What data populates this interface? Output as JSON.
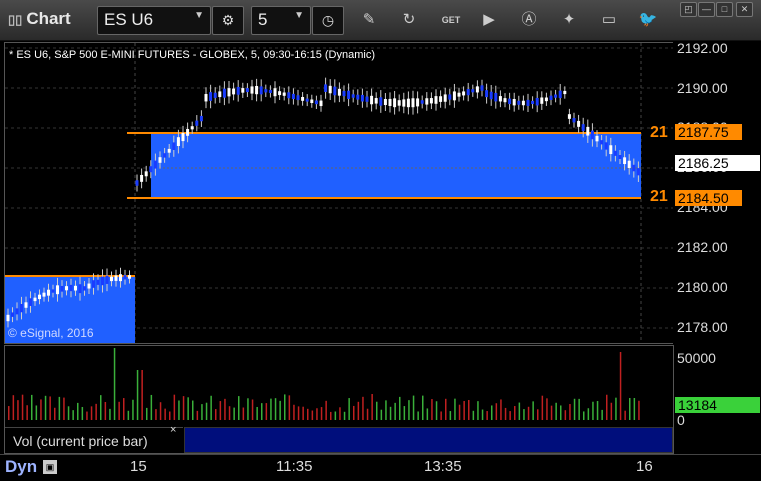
{
  "toolbar": {
    "app_title": "Chart",
    "symbol": "ES U6",
    "interval": "5",
    "icons": [
      "gear-icon",
      "clock-icon",
      "pencil-icon",
      "refresh-icon",
      "get-icon",
      "play-icon",
      "alert-icon",
      "tag-icon",
      "comment-icon",
      "twitter-icon"
    ],
    "get_label": "GET",
    "win_controls": [
      "◰",
      "—",
      "□",
      "✕"
    ]
  },
  "chart": {
    "header": "* ES U6, S&P 500 E-MINI FUTURES - GLOBEX, 5, 09:30-16:15 (Dynamic)",
    "watermark": "© eSignal, 2016",
    "y_labels": [
      "2192.00",
      "2190.00",
      "2188.00",
      "2186.00",
      "2184.00",
      "2182.00",
      "2180.00",
      "2178.00"
    ],
    "price_tags": {
      "upper": "2187.75",
      "current": "2186.25",
      "lower": "2184.50",
      "upper_left": "21",
      "lower_left": "21"
    },
    "colors": {
      "up": "#ffffff",
      "down": "#1a3cff",
      "zone": "#2060ff",
      "level": "#ff8a00",
      "vol_up": "#3ab03a",
      "vol_down": "#c02020",
      "vol_current": "#3ad13a"
    }
  },
  "volume": {
    "y_labels": [
      "50000",
      "0"
    ],
    "current": "13184",
    "label": "Vol (current price bar)",
    "close": "×"
  },
  "x_axis": {
    "dyn": "Dyn",
    "lock": "🔒",
    "ticks": [
      "15",
      "11:35",
      "13:35",
      "16"
    ]
  }
}
